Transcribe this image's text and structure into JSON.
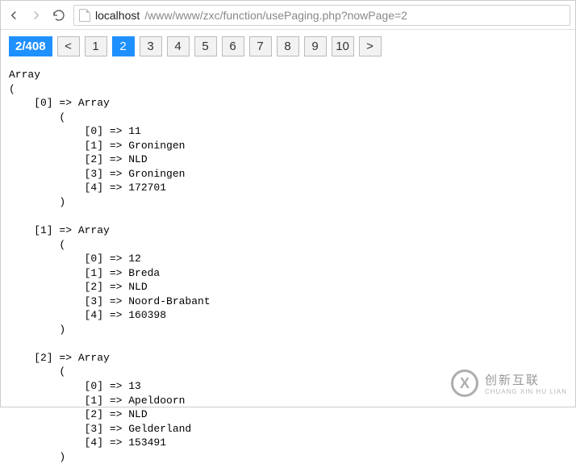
{
  "browser": {
    "url_host": "localhost",
    "url_path": "/www/www/zxc/function/usePaging.php?nowPage=2"
  },
  "pagination": {
    "indicator": "2/408",
    "prev_label": "<",
    "next_label": ">",
    "active_page": "2",
    "pages": [
      "1",
      "2",
      "3",
      "4",
      "5",
      "6",
      "7",
      "8",
      "9",
      "10"
    ]
  },
  "dump": {
    "records": [
      {
        "idx": "0",
        "values": [
          "11",
          "Groningen",
          "NLD",
          "Groningen",
          "172701"
        ]
      },
      {
        "idx": "1",
        "values": [
          "12",
          "Breda",
          "NLD",
          "Noord-Brabant",
          "160398"
        ]
      },
      {
        "idx": "2",
        "values": [
          "13",
          "Apeldoorn",
          "NLD",
          "Gelderland",
          "153491"
        ]
      }
    ]
  },
  "watermark": {
    "logo_letter": "X",
    "cn": "创新互联",
    "en": "CHUANG XIN HU LIAN"
  }
}
